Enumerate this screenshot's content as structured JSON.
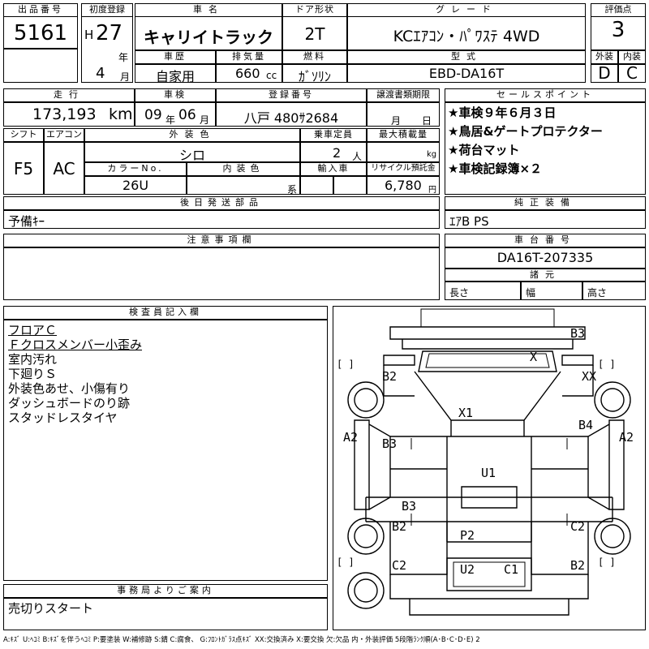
{
  "header": {
    "lot_no_label": "出品番号",
    "lot_no": "5161",
    "first_reg_label": "初度登録",
    "era": "H",
    "year": "27",
    "year_unit": "年",
    "month": "4",
    "month_unit": "月",
    "model_label": "車名",
    "model": "キャリイトラック",
    "door_label": "ドア形状",
    "door": "2T",
    "grade_label": "グレード",
    "grade": "KCｴｱｺﾝ・ﾊﾟﾜｽﾃ 4WD",
    "score_label": "評価点",
    "score": "3",
    "history_label": "車歴",
    "history": "自家用",
    "displacement_label": "排気量",
    "displacement": "660",
    "displacement_unit": "cc",
    "fuel_label": "燃料",
    "fuel": "ｶﾞｿﾘﾝ",
    "type_label": "型式",
    "type": "EBD-DA16T",
    "exterior_grade_label": "外装",
    "exterior_grade": "D",
    "interior_grade_label": "内装",
    "interior_grade": "C"
  },
  "row2": {
    "mileage_label": "走行",
    "mileage": "173,193",
    "mileage_unit": "km",
    "inspection_label": "車検",
    "inspection_year": "09",
    "inspection_year_unit": "年",
    "inspection_month": "06",
    "inspection_month_unit": "月",
    "plate_label": "登録番号",
    "plate": "八戸 480ｻ2684",
    "transfer_label": "譲渡書類期限",
    "transfer_month_unit": "月",
    "transfer_day_unit": "日",
    "sales_label": "セールスポイント",
    "sales_points": [
      "★車検９年６月３日",
      "★鳥居&ゲートプロテクター",
      "★荷台マット",
      "★車検記録簿×２"
    ]
  },
  "row3": {
    "shift_label": "シフト",
    "shift": "F5",
    "ac_label": "エアコン",
    "ac": "AC",
    "color_label": "外装色",
    "color": "シロ",
    "capacity_label": "乗車定員",
    "capacity": "2",
    "capacity_unit": "人",
    "max_load_label": "最大積載量",
    "max_load_unit": "kg",
    "color_no_label": "カラーNo.",
    "color_no": "26U",
    "interior_color_label": "内装色",
    "interior_color_unit": "系",
    "import_label": "輸入車",
    "recycle_label": "リサイクル預託金",
    "recycle": "6,780",
    "recycle_unit": "円"
  },
  "later_parts": {
    "label": "後日発送部品",
    "value": "予備ｷｰ"
  },
  "genuine": {
    "label": "純正装備",
    "value": "ｴｱB PS"
  },
  "notes": {
    "label": "注意事項欄"
  },
  "chassis": {
    "label": "車台番号",
    "value": "DA16T-207335",
    "dims_label": "諸元",
    "length_label": "長さ",
    "width_label": "幅",
    "height_label": "高さ"
  },
  "inspector": {
    "label": "検査員記入欄",
    "lines": [
      "フロアＣ",
      "Ｆクロスメンバー小歪み",
      "室内汚れ",
      "下廻りＳ",
      "外装色あせ、小傷有り",
      "ダッシュボードのり跡",
      "スタッドレスタイヤ"
    ]
  },
  "office": {
    "label": "事務局よりご案内",
    "value": "売切りスタート"
  },
  "diagram_marks": {
    "b3_top": "B3",
    "x": "X",
    "b2_front_left": "B2",
    "xx": "XX",
    "x1": "X1",
    "a2_left": "A2",
    "b3_left": "B3",
    "b4": "B4",
    "a2_right": "A2",
    "u1": "U1",
    "b3_mid": "B3",
    "b2_rear_left": "B2",
    "c2_rear_right": "C2",
    "p2": "P2",
    "c2_bottom_left": "C2",
    "u2": "U2",
    "c1": "C1",
    "b2_bottom_right": "B2",
    "bracket_left_1": "[    ]",
    "bracket_right_1": "[    ]",
    "bracket_left_2": "[    ]",
    "bracket_right_2": "[    ]"
  },
  "legend": "A:ｷｽﾞ U:ﾍｺﾐ B:ｷｽﾞを伴うﾍｺﾐ P:要塗装 W:補修跡 S:錆 C:腐食、 G:ﾌﾛﾝﾄｶﾞﾗｽ点ｷｽﾞ XX:交換済み X:要交換 欠:欠品 内・外装評価 5段階ﾗﾝｸ順(A･B･C･D･E) 2"
}
